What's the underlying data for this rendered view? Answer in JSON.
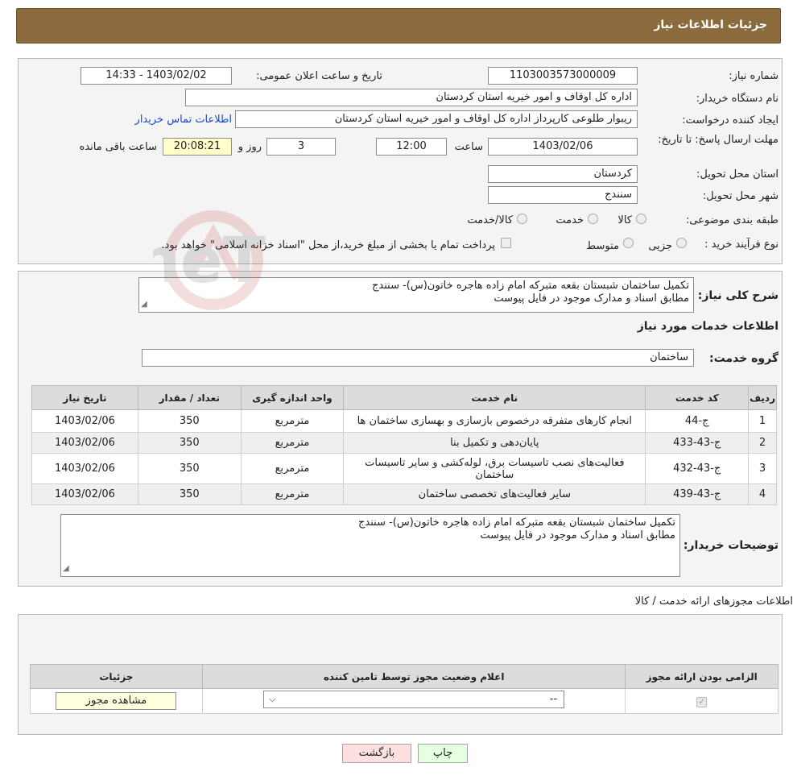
{
  "header": {
    "title": "جزئیات اطلاعات نیاز"
  },
  "form": {
    "need_number_label": "شماره نیاز:",
    "need_number": "1103003573000009",
    "announce_label": "تاریخ و ساعت اعلان عمومی:",
    "announce_value": "1403/02/02 - 14:33",
    "buyer_org_label": "نام دستگاه خریدار:",
    "buyer_org": "اداره کل اوقاف و امور خیریه استان کردستان",
    "creator_label": "ایجاد کننده درخواست:",
    "creator": "ریبوار طلوعی کارپرداز اداره کل اوقاف و امور خیریه استان کردستان",
    "contact_link": "اطلاعات تماس خریدار",
    "deadline_label": "مهلت ارسال پاسخ: تا تاریخ:",
    "deadline_date": "1403/02/06",
    "time_label": "ساعت",
    "deadline_time": "12:00",
    "days_value": "3",
    "days_label": "روز و",
    "remaining_time": "20:08:21",
    "remaining_label": "ساعت باقی مانده",
    "province_label": "استان محل تحویل:",
    "province": "کردستان",
    "city_label": "شهر محل تحویل:",
    "city": "سنندج",
    "category_label": "طبقه بندی موضوعی:",
    "category_options": [
      "کالا",
      "خدمت",
      "کالا/خدمت"
    ],
    "purchase_type_label": "نوع فرآیند خرید :",
    "purchase_options": [
      "جزیی",
      "متوسط"
    ],
    "payment_note": "پرداخت تمام یا بخشی از مبلغ خرید،از محل \"اسناد خزانه اسلامی\" خواهد بود."
  },
  "details": {
    "summary_label": "شرح کلی نیاز:",
    "summary_line1": "تکمیل ساختمان شبستان بقعه متبرکه امام زاده هاجره خاتون(س)- سنندج",
    "summary_line2": "مطابق اسناد و مدارک موجود در فایل پیوست",
    "services_title": "اطلاعات خدمات مورد نیاز",
    "service_group_label": "گروه خدمت:",
    "service_group": "ساختمان",
    "table_headers": [
      "ردیف",
      "کد خدمت",
      "نام خدمت",
      "واحد اندازه گیری",
      "تعداد / مقدار",
      "تاریخ نیاز"
    ],
    "rows": [
      {
        "idx": "1",
        "code": "ج-44",
        "name": "انجام کارهای متفرقه درخصوص بازسازی و بهسازی ساختمان ها",
        "unit": "مترمربع",
        "qty": "350",
        "date": "1403/02/06"
      },
      {
        "idx": "2",
        "code": "ج-43-433",
        "name": "پایان‌دهی و تکمیل بنا",
        "unit": "مترمربع",
        "qty": "350",
        "date": "1403/02/06"
      },
      {
        "idx": "3",
        "code": "ج-43-432",
        "name": "فعالیت‌های نصب تاسیسات برق، لوله‌کشی و سایر تاسیسات ساختمان",
        "unit": "مترمربع",
        "qty": "350",
        "date": "1403/02/06"
      },
      {
        "idx": "4",
        "code": "ج-43-439",
        "name": "سایر فعالیت‌های تخصصی ساختمان",
        "unit": "مترمربع",
        "qty": "350",
        "date": "1403/02/06"
      }
    ],
    "buyer_notes_label": "توضیحات خریدار:",
    "buyer_notes_line1": "تکمیل ساختمان شبستان بقعه متبرکه امام زاده هاجره خاتون(س)- سنندج",
    "buyer_notes_line2": "مطابق اسناد و مدارک موجود در فایل پیوست"
  },
  "permits": {
    "title": "اطلاعات مجوزهای ارائه خدمت / کالا",
    "headers": [
      "الزامی بودن ارائه مجوز",
      "اعلام وضعیت مجوز توسط تامین کننده",
      "جزئیات"
    ],
    "status_value": "--",
    "view_button": "مشاهده مجوز"
  },
  "buttons": {
    "print": "چاپ",
    "back": "بازگشت"
  },
  "watermark": {
    "text": "AriaTender.neT"
  },
  "colors": {
    "header_bg": "#8b6a3e",
    "link": "#1a47c8",
    "back_bg": "#ffe0e0",
    "print_bg": "#e6ffe0",
    "remaining_bg": "#ffffcc"
  }
}
